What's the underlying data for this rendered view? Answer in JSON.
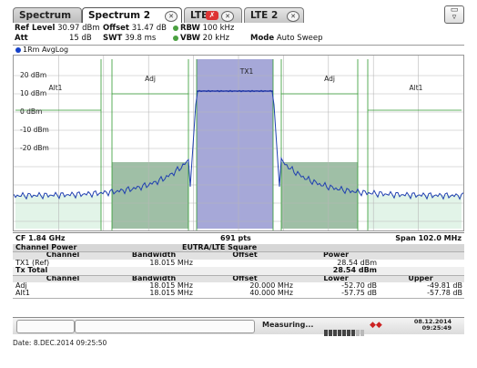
{
  "tabs": [
    {
      "label": "Spectrum",
      "has_close": false,
      "has_error": false
    },
    {
      "label": "Spectrum 2",
      "has_close": true,
      "has_error": false
    },
    {
      "label": "LTE",
      "has_close": true,
      "has_error": true
    },
    {
      "label": "LTE 2",
      "has_close": true,
      "has_error": false
    }
  ],
  "corner_button_icon": "overview-icon",
  "settings": {
    "ref_level_label": "Ref Level",
    "ref_level_value": "30.97 dBm",
    "offset_label": "Offset",
    "offset_value": "31.47 dB",
    "rbw_label": "RBW",
    "rbw_value": "100 kHz",
    "att_label": "Att",
    "att_value": "15 dB",
    "swt_label": "SWT",
    "swt_value": "39.8 ms",
    "vbw_label": "VBW",
    "vbw_value": "20 kHz",
    "mode_label": "Mode",
    "mode_value": "Auto Sweep"
  },
  "trace_label": "1Rm AvgLog",
  "y_axis_labels": [
    "20 dBm",
    "10 dBm",
    "0 dBm",
    "-10 dBm",
    "-20 dBm"
  ],
  "channel_labels": {
    "left_alt": "Alt1",
    "left_adj": "Adj",
    "tx": "TX1",
    "right_adj": "Adj",
    "right_alt": "Alt1"
  },
  "channel_power_levels_dBm": {
    "alt_left": -45.5,
    "adj_left": -27.5,
    "tx": 11.5,
    "adj_right": -27.5,
    "alt_right": -45.5
  },
  "colors": {
    "tx_fill": "#a6a8d8",
    "adj_fill": "#9fbfa6",
    "alt_fill": "#e2f4e8",
    "trace": "#1f3fb0",
    "grid": "#b8b8b8",
    "limit_green": "#2f9a2f"
  },
  "freq_bar": {
    "cf": "CF 1.84 GHz",
    "pts": "691 pts",
    "span": "Span 102.0 MHz"
  },
  "results": {
    "title_left": "Channel Power",
    "title_center": "EUTRA/LTE Square",
    "tx_header": [
      "Channel",
      "Bandwidth",
      "Offset",
      "Power"
    ],
    "tx_rows": [
      {
        "channel": "TX1 (Ref)",
        "bandwidth": "18.015 MHz",
        "offset": "",
        "power": "28.54 dBm"
      }
    ],
    "tx_total_label": "Tx Total",
    "tx_total_value": "28.54 dBm",
    "adj_header": [
      "Channel",
      "Bandwidth",
      "Offset",
      "Lower",
      "Upper"
    ],
    "adj_rows": [
      {
        "channel": "Adj",
        "bandwidth": "18.015 MHz",
        "offset": "20.000 MHz",
        "lower": "-52.70 dB",
        "upper": "-49.81 dB"
      },
      {
        "channel": "Alt1",
        "bandwidth": "18.015 MHz",
        "offset": "40.000 MHz",
        "lower": "-57.75 dB",
        "upper": "-57.78 dB"
      }
    ]
  },
  "status": {
    "measuring_label": "Measuring...",
    "progress_filled": 7,
    "progress_total": 9,
    "date_short": "08.12.2014",
    "time_short": "09:25:49"
  },
  "footer_text": "Date: 8.DEC.2014  09:25:50"
}
